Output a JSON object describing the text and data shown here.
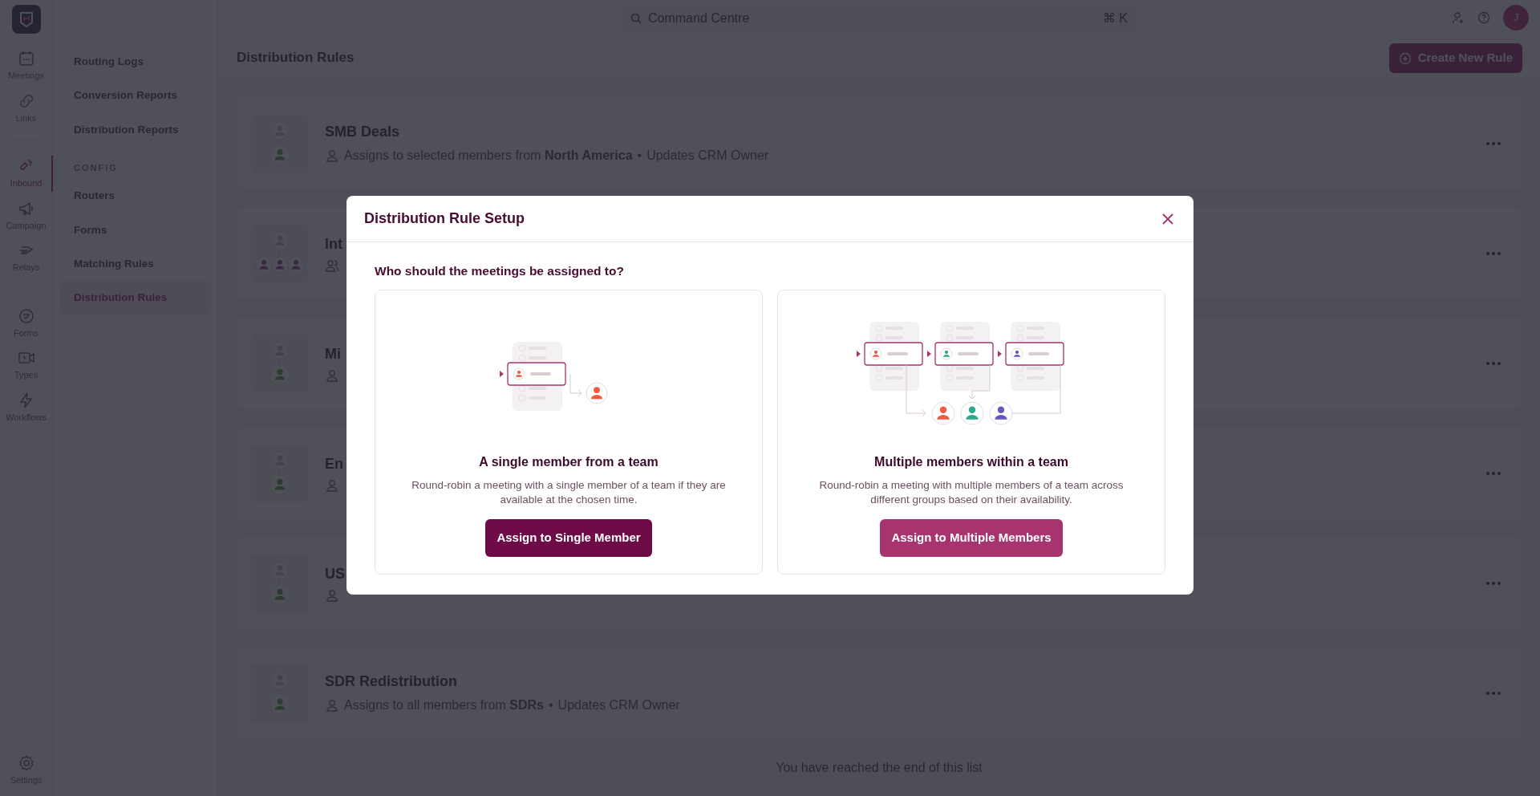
{
  "topbar": {
    "search": {
      "placeholder": "Command Centre",
      "shortcut": "⌘ K"
    },
    "avatar": "J"
  },
  "rail": {
    "groups": [
      [
        {
          "label": "Meetings",
          "selected": false
        },
        {
          "label": "Links",
          "selected": false
        }
      ],
      [
        {
          "label": "Inbound",
          "selected": true
        },
        {
          "label": "Campaign",
          "selected": false
        },
        {
          "label": "Relays",
          "selected": false
        }
      ],
      [
        {
          "label": "Forms",
          "selected": false
        },
        {
          "label": "Types",
          "selected": false
        },
        {
          "label": "Workflows",
          "selected": false
        }
      ]
    ],
    "settings": "Settings"
  },
  "subnav": {
    "items": [
      {
        "label": "Routing Logs",
        "selected": false
      },
      {
        "label": "Conversion Reports",
        "selected": false
      },
      {
        "label": "Distribution Reports",
        "selected": false
      }
    ],
    "section": "CONFIG",
    "config_items": [
      {
        "label": "Routers",
        "selected": false
      },
      {
        "label": "Forms",
        "selected": false
      },
      {
        "label": "Matching Rules",
        "selected": false
      },
      {
        "label": "Distribution Rules",
        "selected": true
      }
    ]
  },
  "header": {
    "title": "Distribution Rules",
    "create_button": "Create New Rule"
  },
  "rules": [
    {
      "title": "SMB Deals",
      "kind": "single",
      "summary": "Assigns to selected members from **North America**",
      "separator": "•",
      "extra": "Updates CRM Owner"
    },
    {
      "title": "Int",
      "kind": "multiple"
    },
    {
      "title": "Mi",
      "kind": "single"
    },
    {
      "title": "En",
      "kind": "single"
    },
    {
      "title": "US",
      "kind": "single"
    },
    {
      "title": "SDR Redistribution",
      "kind": "single",
      "summary": "Assigns to all members from **SDRs**",
      "separator": "•",
      "extra": "Updates CRM Owner"
    }
  ],
  "end_note": "You have reached the end of this list",
  "modal": {
    "title": "Distribution Rule Setup",
    "question": "Who should the meetings be assigned to?",
    "options": [
      {
        "kind": "single",
        "title": "A single member from a team",
        "description": "Round-robin a meeting with a single member of a team if they are available at the chosen time.",
        "button": "Assign to Single Member",
        "primary": true
      },
      {
        "kind": "multiple",
        "title": "Multiple members within a team",
        "description": "Round-robin a meeting with multiple members of a team across different groups based on their availability.",
        "button": "Assign to Multiple Members",
        "primary": false
      }
    ]
  }
}
